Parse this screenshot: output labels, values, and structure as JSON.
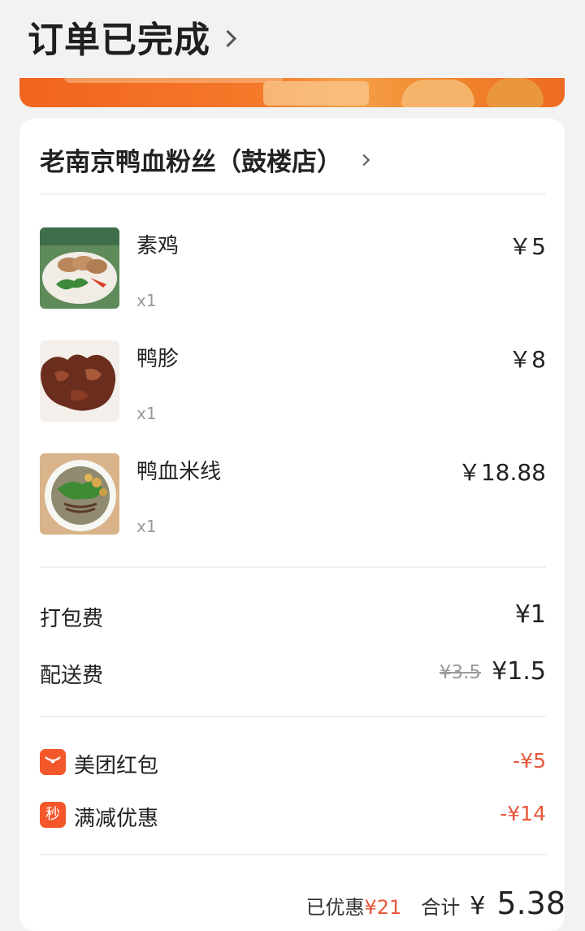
{
  "header": {
    "status_title": "订单已完成"
  },
  "colors": {
    "accent": "#f4582a",
    "discount": "#e8573b",
    "banner": "#f0641e"
  },
  "shop": {
    "name": "老南京鸭血粉丝（鼓楼店）"
  },
  "items": [
    {
      "name": "素鸡",
      "quantity": "x1",
      "price": "￥5"
    },
    {
      "name": "鸭胗",
      "quantity": "x1",
      "price": "￥8"
    },
    {
      "name": "鸭血米线",
      "quantity": "x1",
      "price": "￥18.88"
    }
  ],
  "fees": {
    "packing": {
      "label": "打包费",
      "value": "¥1"
    },
    "delivery": {
      "label": "配送费",
      "original": "¥3.5",
      "value": "¥1.5"
    }
  },
  "promotions": [
    {
      "icon": "red-packet-icon",
      "label": "美团红包",
      "value": "-¥5"
    },
    {
      "icon": "flash-sale-icon",
      "icon_text": "秒",
      "label": "满减优惠",
      "value": "-¥14"
    }
  ],
  "summary": {
    "saved_label": "已优惠",
    "saved_value": "¥21",
    "total_label": "合计",
    "currency": "¥",
    "total_value": "5.38"
  }
}
